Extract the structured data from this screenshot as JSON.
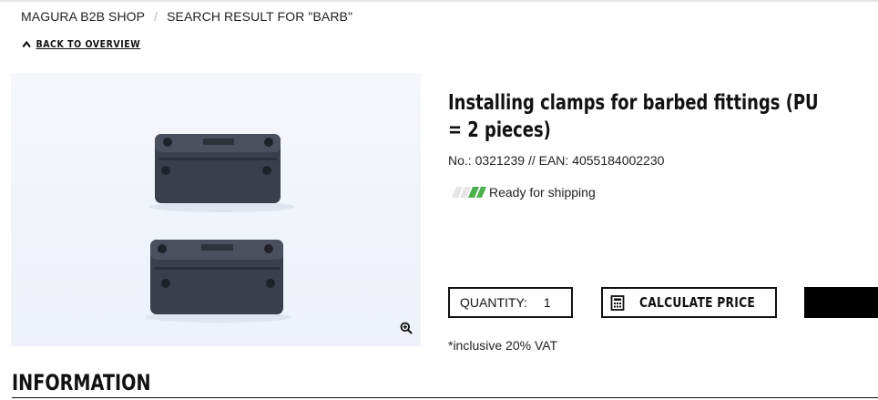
{
  "breadcrumb": {
    "items": [
      "MAGURA B2B SHOP",
      "SEARCH RESULT FOR \"BARB\""
    ],
    "separator": "/"
  },
  "back_link": {
    "label": "BACK TO OVERVIEW",
    "icon": "chevron-up-icon"
  },
  "product": {
    "image_alt": "Installing clamps for barbed fittings",
    "zoom_icon": "zoom-in-icon",
    "title": "Installing clamps for barbed fittings (PU = 2 pieces)",
    "numbers": "No.: 0321239 // EAN: 4055184002230",
    "stock": {
      "label": "Ready for shipping",
      "icon": "stock-indicator-icon",
      "level": 1.0
    }
  },
  "purchase": {
    "quantity_label": "QUANTITY:",
    "quantity_value": "1",
    "calculate_label": "CALCULATE PRICE",
    "calculate_icon": "calculator-icon",
    "cart_label": ""
  },
  "vat_note": "*inclusive 20% VAT",
  "sections": {
    "information_heading": "INFORMATION"
  },
  "colors": {
    "accent_green": "#4caf50",
    "text": "#111111",
    "image_bg": "#f1f4fc"
  }
}
